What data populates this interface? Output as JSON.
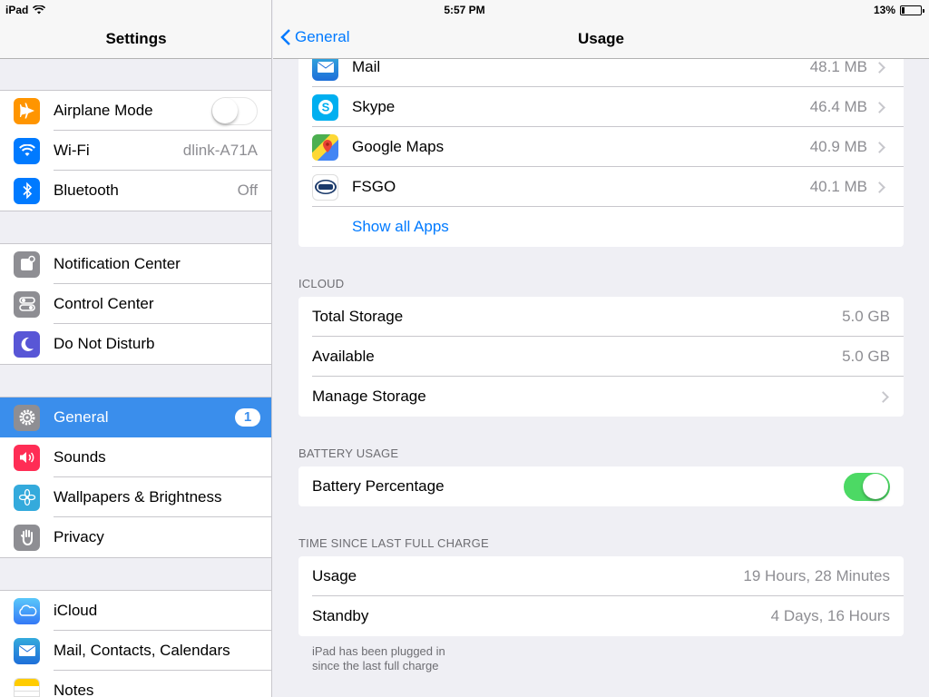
{
  "status_bar": {
    "device": "iPad",
    "time": "5:57 PM",
    "battery": "13%",
    "battery_level": 0.13
  },
  "sidebar": {
    "title": "Settings",
    "groups": [
      [
        {
          "label": "Airplane Mode",
          "icon": "airplane-icon",
          "color": "#ff9500",
          "toggle": false
        },
        {
          "label": "Wi-Fi",
          "icon": "wifi-icon",
          "color": "#007aff",
          "value": "dlink-A71A"
        },
        {
          "label": "Bluetooth",
          "icon": "bluetooth-icon",
          "color": "#007aff",
          "value": "Off"
        }
      ],
      [
        {
          "label": "Notification Center",
          "icon": "notification-center-icon",
          "color": "#8e8e93"
        },
        {
          "label": "Control Center",
          "icon": "control-center-icon",
          "color": "#8e8e93"
        },
        {
          "label": "Do Not Disturb",
          "icon": "moon-icon",
          "color": "#5856d6"
        }
      ],
      [
        {
          "label": "General",
          "icon": "gear-icon",
          "color": "#8e8e93",
          "badge": "1",
          "selected": true
        },
        {
          "label": "Sounds",
          "icon": "speaker-icon",
          "color": "#ff2d55"
        },
        {
          "label": "Wallpapers & Brightness",
          "icon": "flower-icon",
          "color": "#34aadc"
        },
        {
          "label": "Privacy",
          "icon": "hand-icon",
          "color": "#8e8e93"
        }
      ],
      [
        {
          "label": "iCloud",
          "icon": "cloud-icon",
          "color": "#5ac8fa"
        },
        {
          "label": "Mail, Contacts, Calendars",
          "icon": "envelope-icon",
          "color": "#1e88e5"
        },
        {
          "label": "Notes",
          "icon": "notes-icon",
          "color": "#ffcc00"
        }
      ]
    ]
  },
  "detail": {
    "back_label": "General",
    "title": "Usage",
    "apps": [
      {
        "name": "Mail",
        "size": "48.1 MB",
        "icon": "mail-app-icon"
      },
      {
        "name": "Skype",
        "size": "46.4 MB",
        "icon": "skype-icon"
      },
      {
        "name": "Google Maps",
        "size": "40.9 MB",
        "icon": "google-maps-icon"
      },
      {
        "name": "FSGO",
        "size": "40.1 MB",
        "icon": "fsgo-icon"
      }
    ],
    "show_all_apps": "Show all Apps",
    "icloud": {
      "header": "ICLOUD",
      "total_storage_label": "Total Storage",
      "total_storage_value": "5.0 GB",
      "available_label": "Available",
      "available_value": "5.0 GB",
      "manage_storage_label": "Manage Storage"
    },
    "battery": {
      "header": "BATTERY USAGE",
      "percentage_label": "Battery Percentage",
      "percentage_on": true
    },
    "charge": {
      "header": "TIME SINCE LAST FULL CHARGE",
      "usage_label": "Usage",
      "usage_value": "19 Hours, 28 Minutes",
      "standby_label": "Standby",
      "standby_value": "4 Days, 16 Hours",
      "note_line1": "iPad has been plugged in",
      "note_line2": "since the last full charge"
    }
  }
}
